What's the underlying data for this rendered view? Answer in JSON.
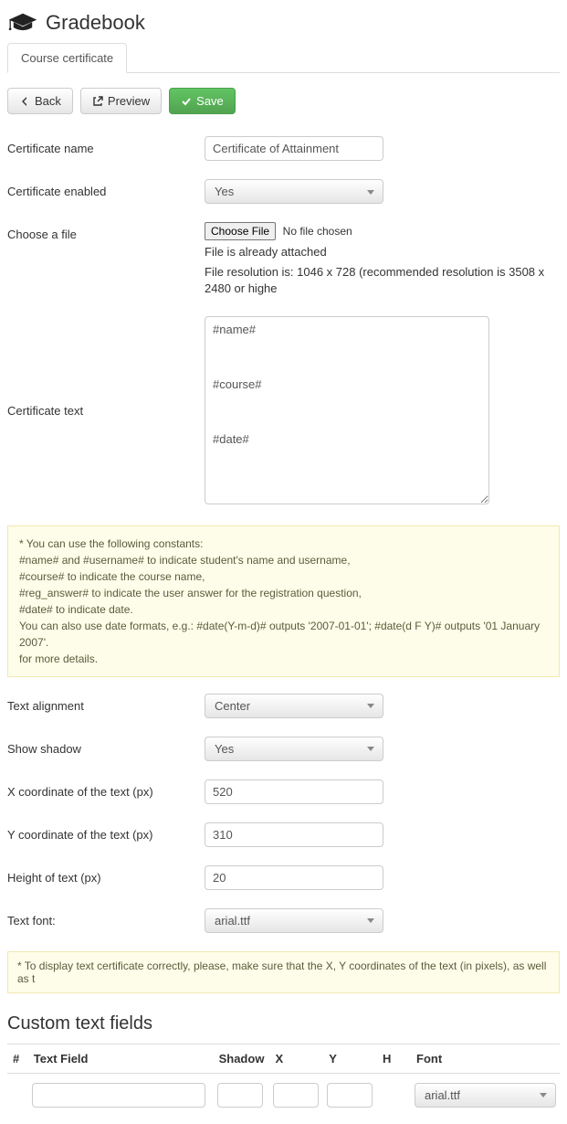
{
  "header": {
    "title": "Gradebook"
  },
  "tabs": [
    {
      "label": "Course certificate"
    }
  ],
  "actions": {
    "back": "Back",
    "preview": "Preview",
    "save": "Save"
  },
  "form": {
    "name_label": "Certificate name",
    "name_value": "Certificate of Attainment",
    "enabled_label": "Certificate enabled",
    "enabled_value": "Yes",
    "file_label": "Choose a file",
    "file_button": "Choose File",
    "file_status": "No file chosen",
    "file_help1": "File is already attached",
    "file_help2": "File resolution is: 1046 x 728 (recommended resolution is 3508 x 2480 or highe",
    "text_label": "Certificate text",
    "text_value": "#name#\n\n\n\n#course#\n\n\n\n#date#",
    "align_label": "Text alignment",
    "align_value": "Center",
    "shadow_label": "Show shadow",
    "shadow_value": "Yes",
    "x_label": "X coordinate of the text (px)",
    "x_value": "520",
    "y_label": "Y coordinate of the text (px)",
    "y_value": "310",
    "h_label": "Height of text (px)",
    "h_value": "20",
    "font_label": "Text font:",
    "font_value": "arial.ttf"
  },
  "info1": {
    "l1": "* You can use the following constants:",
    "l2": "#name# and #username# to indicate student's name and username,",
    "l3": "#course# to indicate the course name,",
    "l4": "#reg_answer# to indicate the user answer for the registration question,",
    "l5": "#date# to indicate date.",
    "l6": "You can also use date formats, e.g.: #date(Y-m-d)# outputs '2007-01-01'; #date(d F Y)# outputs '01 January 2007'.",
    "l7": "for more details."
  },
  "info2": "* To display text certificate correctly, please, make sure that the X, Y coordinates of the text (in pixels), as well as t",
  "custom": {
    "title": "Custom text fields",
    "cols": {
      "num": "#",
      "tf": "Text Field",
      "shadow": "Shadow",
      "x": "X",
      "y": "Y",
      "h": "H",
      "font": "Font"
    },
    "row": {
      "font": "arial.ttf"
    }
  }
}
